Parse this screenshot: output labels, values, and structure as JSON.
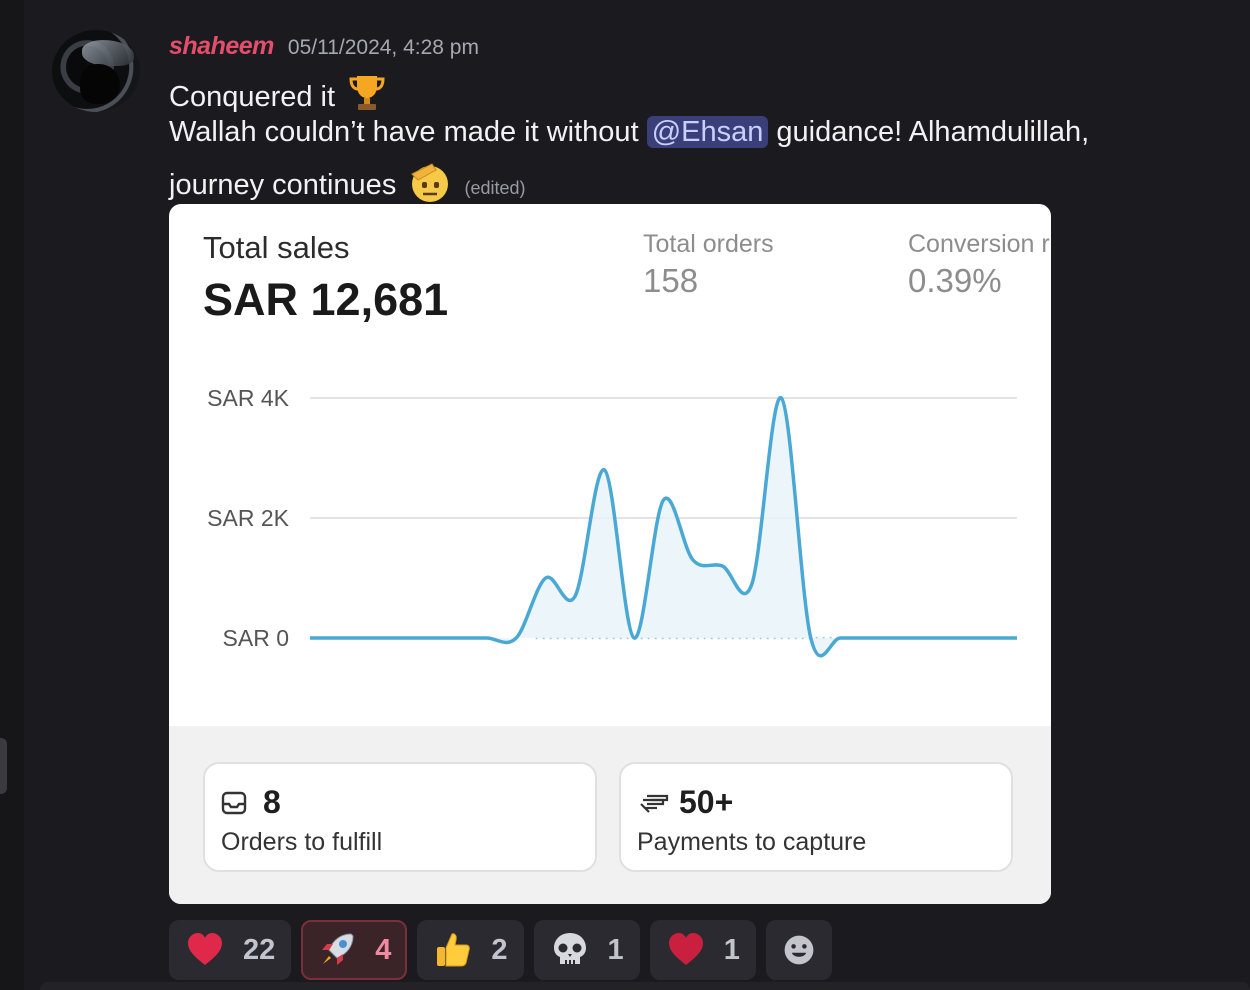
{
  "message": {
    "username": "shaheem",
    "timestamp": "05/11/2024, 4:28 pm",
    "line1": "Conquered it",
    "line2_before": "Wallah couldn’t have made it without",
    "mention": "@Ehsan",
    "line2_after": "guidance! Alhamdulillah,",
    "line3": "journey continues",
    "edited": "(edited)",
    "username_color": "#e34f6a",
    "mention_bg": "#3a3f7a"
  },
  "card": {
    "total_sales_label": "Total sales",
    "total_sales_value": "SAR 12,681",
    "total_orders_label": "Total orders",
    "total_orders_value": "158",
    "conversion_label": "Conversion r",
    "conversion_value": "0.39%",
    "stats": [
      {
        "icon": "inbox-icon",
        "value": "8",
        "label": "Orders to fulfill"
      },
      {
        "icon": "cash-icon",
        "value": "50+",
        "label": "Payments to capture"
      }
    ]
  },
  "chart_data": {
    "type": "line",
    "title": "",
    "xlabel": "",
    "ylabel": "",
    "y_ticks": [
      "SAR 4K",
      "SAR 2K",
      "SAR 0"
    ],
    "ylim": [
      0,
      4000
    ],
    "grid": true,
    "line_color": "#4aa8d4",
    "x": [
      0,
      1,
      2,
      3,
      4,
      5,
      6,
      7,
      8,
      9,
      10,
      11,
      12,
      13,
      14,
      15,
      16,
      17,
      18,
      19,
      20,
      21,
      22,
      23,
      24
    ],
    "series": [
      {
        "name": "",
        "values": [
          0,
          0,
          0,
          0,
          0,
          0,
          0,
          0,
          1000,
          700,
          2800,
          0,
          2300,
          1300,
          1200,
          900,
          4000,
          0,
          0,
          0,
          0,
          0,
          0,
          0,
          0
        ]
      }
    ]
  },
  "reactions": [
    {
      "emoji": "heart-icon",
      "count": "22",
      "active": false
    },
    {
      "emoji": "rocket-icon",
      "count": "4",
      "active": true
    },
    {
      "emoji": "thumbs-up-icon",
      "count": "2",
      "active": false
    },
    {
      "emoji": "skull-icon",
      "count": "1",
      "active": false
    },
    {
      "emoji": "heart-icon",
      "count": "1",
      "active": false
    }
  ]
}
